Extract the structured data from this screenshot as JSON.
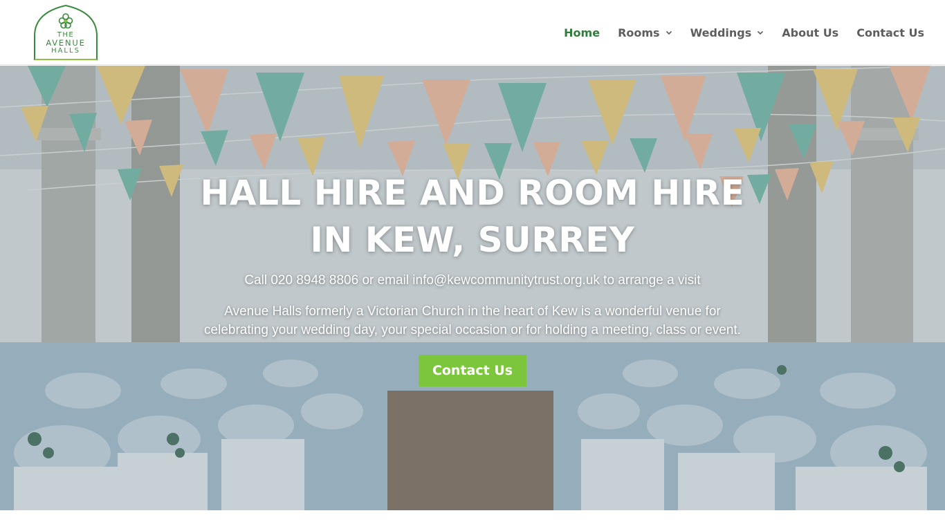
{
  "logo": {
    "line1": "THE",
    "line2": "AVENUE",
    "line3": "HALLS",
    "color": "#3a8a3e",
    "accent": "#8cc43f"
  },
  "nav": {
    "items": [
      {
        "label": "Home",
        "active": true,
        "dropdown": false
      },
      {
        "label": "Rooms",
        "active": false,
        "dropdown": true
      },
      {
        "label": "Weddings",
        "active": false,
        "dropdown": true
      },
      {
        "label": "About Us",
        "active": false,
        "dropdown": false
      },
      {
        "label": "Contact Us",
        "active": false,
        "dropdown": false
      }
    ],
    "active_color": "#2f7e3c",
    "text_color": "#5e5e5e"
  },
  "hero": {
    "title_line1": "HALL HIRE AND ROOM HIRE",
    "title_line2": "IN KEW, SURREY",
    "contact_line": "Call 020 8948 8806 or email info@kewcommunitytrust.org.uk to arrange a visit",
    "description": "Avenue Halls formerly a Victorian Church in the heart of Kew is a wonderful venue for celebrating your wedding day, your special occasion or for holding a meeting, class or event.",
    "button_label": "Contact Us",
    "button_color": "#7cc63e"
  }
}
